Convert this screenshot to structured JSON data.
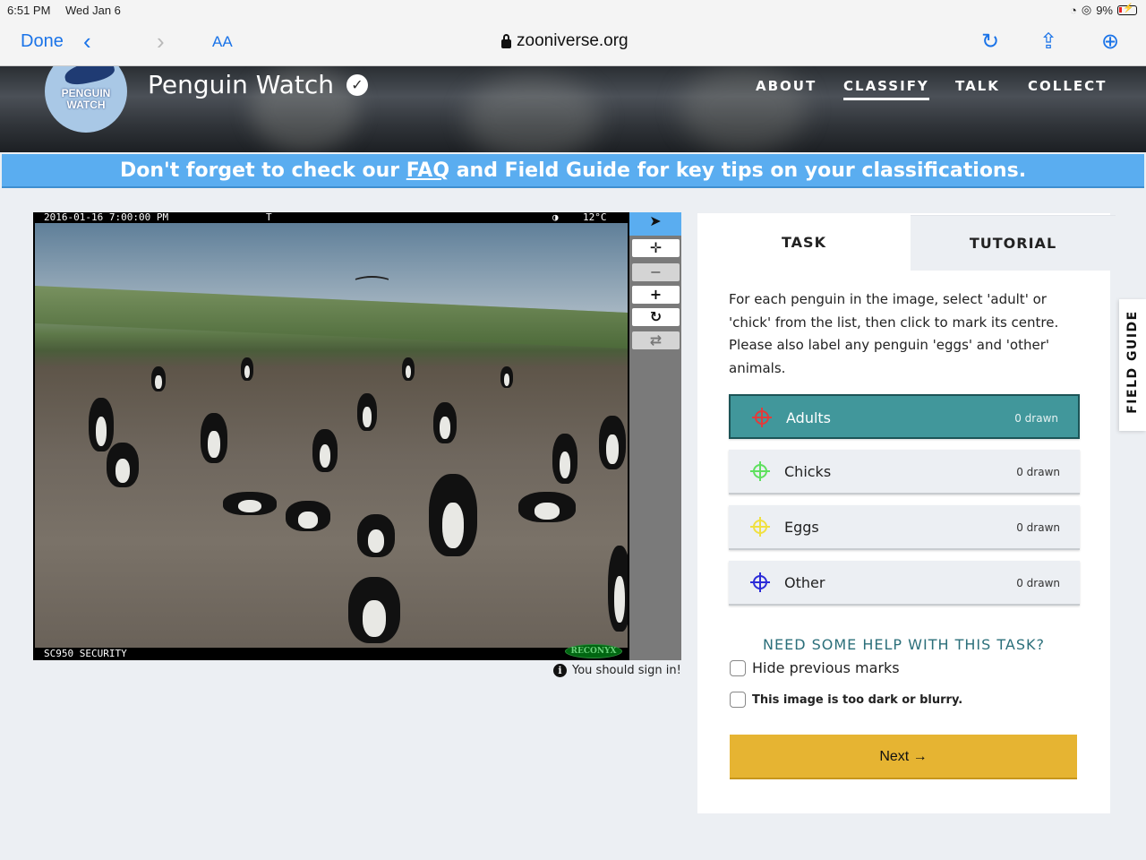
{
  "status": {
    "time": "6:51 PM",
    "date": "Wed Jan 6",
    "battery": "9%"
  },
  "browser": {
    "done": "Done",
    "text_size": "AA",
    "url": "zooniverse.org"
  },
  "site": {
    "logo_text": "PENGUIN WATCH",
    "title": "Penguin Watch",
    "nav": [
      "ABOUT",
      "CLASSIFY",
      "TALK",
      "COLLECT"
    ],
    "active_nav": "CLASSIFY"
  },
  "banner": {
    "pre": "Don't forget to check our ",
    "faq": "FAQ",
    "post": " and Field Guide for key tips on your classifications."
  },
  "viewer": {
    "timestamp": "2016-01-16 7:00:00 PM",
    "tag": "T",
    "temperature": "12°C",
    "camera": "SC950 SECURITY",
    "brand": "RECONYX",
    "sign_in": "You should sign in!"
  },
  "tools": [
    {
      "name": "pointer",
      "icon": "pointer-icon"
    },
    {
      "name": "pan",
      "icon": "move-icon"
    },
    {
      "name": "zoom-out",
      "icon": "minus-icon"
    },
    {
      "name": "zoom-in",
      "icon": "plus-icon"
    },
    {
      "name": "rotate",
      "icon": "rotate-icon"
    },
    {
      "name": "reset",
      "icon": "reset-icon"
    }
  ],
  "task": {
    "tab_task": "TASK",
    "tab_tutorial": "TUTORIAL",
    "instructions": "For each penguin in the image, select 'adult' or 'chick' from the list, then click to mark its centre. Please also label any penguin 'eggs' and 'other' animals.",
    "choices": [
      {
        "label": "Adults",
        "count": "0 drawn",
        "color": "#e23b3b"
      },
      {
        "label": "Chicks",
        "count": "0 drawn",
        "color": "#5ee05e"
      },
      {
        "label": "Eggs",
        "count": "0 drawn",
        "color": "#f0e040"
      },
      {
        "label": "Other",
        "count": "0 drawn",
        "color": "#2b2bd8"
      }
    ],
    "help": "NEED SOME HELP WITH THIS TASK?",
    "hide_marks": "Hide previous marks",
    "too_dark": "This image is too dark or blurry.",
    "next": "Next"
  },
  "field_guide": "FIELD GUIDE"
}
